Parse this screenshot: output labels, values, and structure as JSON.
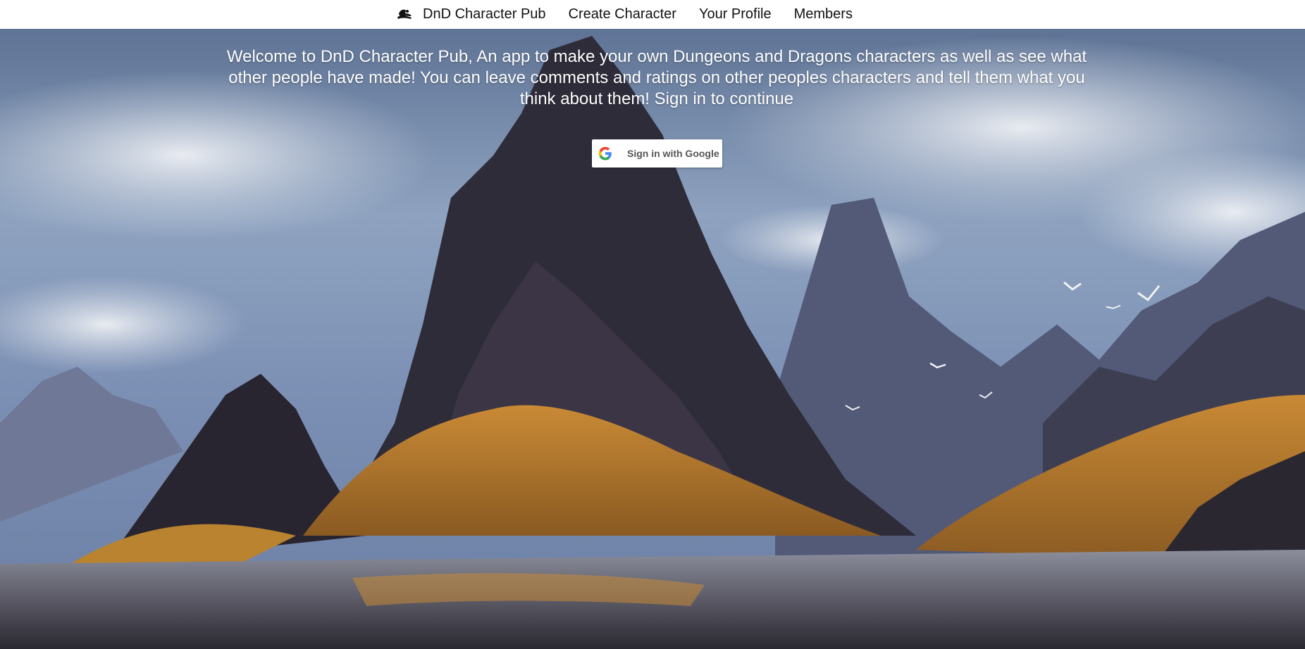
{
  "navbar": {
    "brand_icon": "hat-icon",
    "brand_label": "DnD Character Pub",
    "links": [
      {
        "label": "Create Character"
      },
      {
        "label": "Your Profile"
      },
      {
        "label": "Members"
      }
    ]
  },
  "hero": {
    "welcome_text": "Welcome to DnD Character Pub, An app to make your own Dungeons and Dragons characters as well as see what other people have made! You can leave comments and ratings on other peoples characters and tell them what you think about them! Sign in to continue",
    "google_button_label": "Sign in with Google",
    "google_icon": "google-logo-icon"
  },
  "colors": {
    "sky": "#8fa4c2",
    "mountain_dark": "#2f2c38",
    "golden": "#d99a3a",
    "water": "#6d6f7d"
  }
}
